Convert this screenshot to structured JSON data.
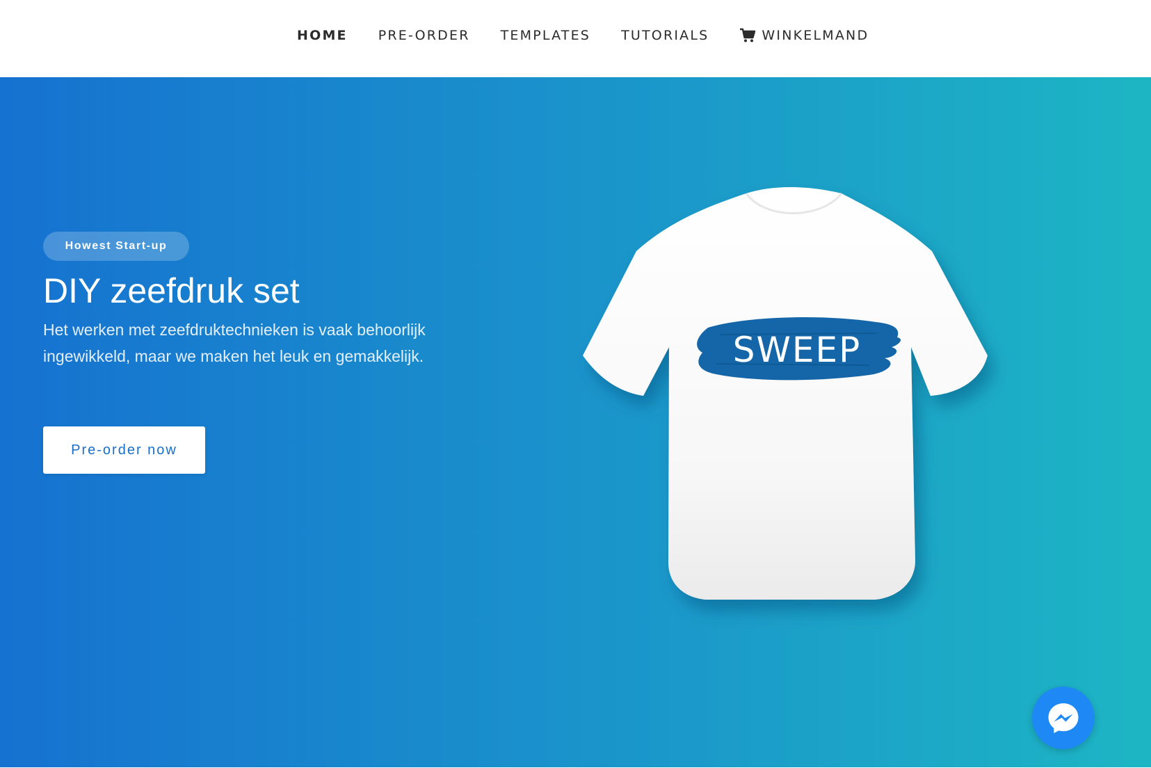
{
  "nav": {
    "items": [
      {
        "label": "HOME",
        "active": true
      },
      {
        "label": "PRE-ORDER",
        "active": false
      },
      {
        "label": "TEMPLATES",
        "active": false
      },
      {
        "label": "TUTORIALS",
        "active": false
      },
      {
        "label": "WINKELMAND",
        "active": false,
        "icon": "shopping-cart-icon"
      }
    ]
  },
  "hero": {
    "badge": "Howest Start-up",
    "title": "DIY zeefdruk set",
    "description": "Het werken met zeefdruktechnieken is vaak behoorlijk ingewikkeld, maar we maken het leuk en gemakkelijk.",
    "cta_label": "Pre-order now",
    "product_print_text": "SWEEP",
    "gradient": {
      "start": "#1672d0",
      "end": "#1db5c4"
    }
  },
  "messenger": {
    "icon": "messenger-icon",
    "color": "#1e88f5"
  }
}
